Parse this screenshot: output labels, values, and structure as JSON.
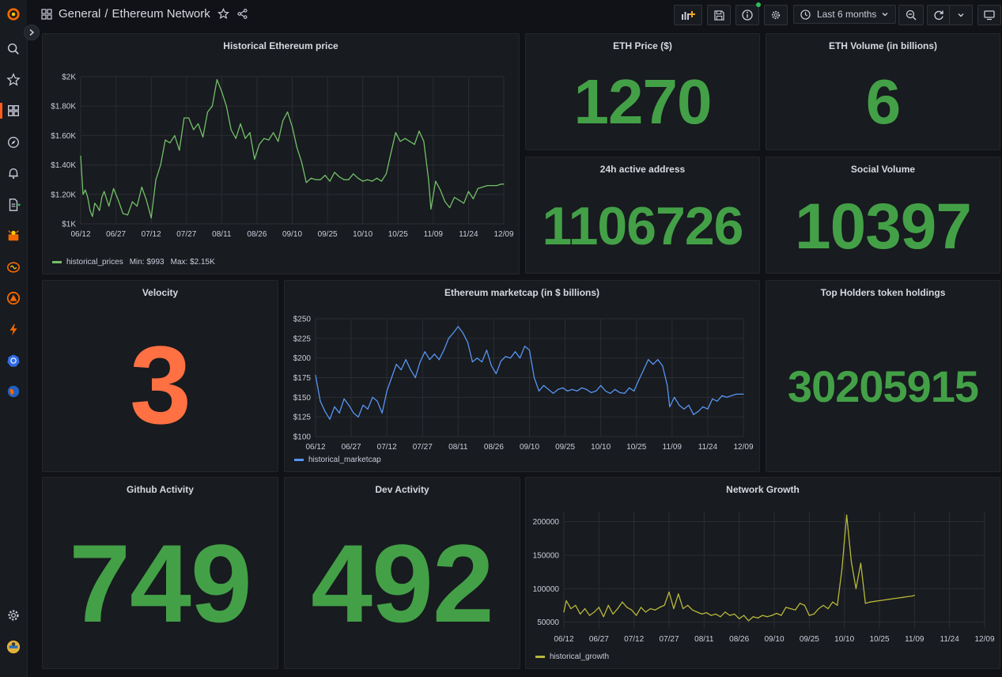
{
  "breadcrumb": {
    "folder": "General",
    "separator": "/",
    "dashboard": "Ethereum Network"
  },
  "time_picker": {
    "label": "Last 6 months"
  },
  "colors": {
    "stat_green": "#43a047",
    "velocity_orange": "#ff7043",
    "price_line": "#73bf69",
    "marketcap_line": "#5794f2",
    "growth_line": "#b8b83a"
  },
  "sidebar_icons": [
    "grafana-logo-icon",
    "search-icon",
    "star-icon",
    "dashboards-icon",
    "explore-icon",
    "alerting-icon",
    "reports-icon",
    "plugin-app-icon",
    "brain-plugin-icon",
    "plugin-app-icon",
    "lightning-icon",
    "kubernetes-icon",
    "globe-icon",
    "gear-icon",
    "avatar"
  ],
  "panels": {
    "price_chart": {
      "title": "Historical Ethereum price",
      "legend": {
        "name": "historical_prices",
        "min": "Min: $993",
        "max": "Max: $2.15K"
      }
    },
    "eth_price": {
      "title": "ETH Price ($)",
      "value": "1270"
    },
    "eth_volume": {
      "title": "ETH Volume (in billions)",
      "value": "6"
    },
    "active_address": {
      "title": "24h active address",
      "value": "1106726"
    },
    "social_volume": {
      "title": "Social Volume",
      "value": "10397"
    },
    "velocity": {
      "title": "Velocity",
      "value": "3"
    },
    "marketcap_chart": {
      "title": "Ethereum marketcap (in $ billions)",
      "legend": {
        "name": "historical_marketcap"
      }
    },
    "top_holders": {
      "title": "Top Holders token holdings",
      "value": "30205915"
    },
    "github": {
      "title": "Github Activity",
      "value": "749"
    },
    "dev": {
      "title": "Dev Activity",
      "value": "492"
    },
    "growth_chart": {
      "title": "Network Growth",
      "legend": {
        "name": "historical_growth"
      }
    }
  },
  "chart_data": [
    {
      "type": "line",
      "title": "Historical Ethereum price",
      "xticks": [
        "06/12",
        "06/27",
        "07/12",
        "07/27",
        "08/11",
        "08/26",
        "09/10",
        "09/25",
        "10/10",
        "10/25",
        "11/09",
        "11/24",
        "12/09"
      ],
      "yticks": [
        "$1K",
        "$1.20K",
        "$1.40K",
        "$1.60K",
        "$1.80K",
        "$2K"
      ],
      "ylim": [
        1000,
        2000
      ],
      "x_start": "06/12",
      "x_days": 180,
      "series": [
        {
          "name": "historical_prices",
          "x": [
            "06/12",
            "06/13",
            "06/14",
            "06/15",
            "06/16",
            "06/17",
            "06/18",
            "06/19",
            "06/20",
            "06/21",
            "06/22",
            "06/24",
            "06/26",
            "06/28",
            "06/30",
            "07/02",
            "07/04",
            "07/06",
            "07/08",
            "07/10",
            "07/12",
            "07/14",
            "07/16",
            "07/18",
            "07/20",
            "07/22",
            "07/24",
            "07/26",
            "07/28",
            "07/30",
            "08/01",
            "08/03",
            "08/05",
            "08/07",
            "08/09",
            "08/11",
            "08/13",
            "08/15",
            "08/17",
            "08/19",
            "08/21",
            "08/23",
            "08/25",
            "08/27",
            "08/29",
            "08/31",
            "09/02",
            "09/04",
            "09/06",
            "09/08",
            "09/10",
            "09/12",
            "09/14",
            "09/16",
            "09/18",
            "09/20",
            "09/22",
            "09/24",
            "09/26",
            "09/28",
            "09/30",
            "10/02",
            "10/04",
            "10/06",
            "10/08",
            "10/10",
            "10/12",
            "10/14",
            "10/16",
            "10/18",
            "10/20",
            "10/22",
            "10/24",
            "10/26",
            "10/28",
            "10/30",
            "11/01",
            "11/03",
            "11/05",
            "11/07",
            "11/08",
            "11/10",
            "11/12",
            "11/14",
            "11/16",
            "11/18",
            "11/20",
            "11/22",
            "11/24",
            "11/26",
            "11/28",
            "11/30",
            "12/02",
            "12/04",
            "12/06",
            "12/08",
            "12/09"
          ],
          "values": [
            1460,
            1200,
            1230,
            1180,
            1090,
            1050,
            1140,
            1120,
            1090,
            1180,
            1220,
            1120,
            1240,
            1160,
            1070,
            1060,
            1150,
            1120,
            1250,
            1160,
            1040,
            1300,
            1400,
            1570,
            1550,
            1600,
            1500,
            1720,
            1720,
            1640,
            1680,
            1590,
            1760,
            1800,
            1980,
            1900,
            1800,
            1640,
            1580,
            1680,
            1580,
            1620,
            1440,
            1540,
            1580,
            1570,
            1620,
            1560,
            1700,
            1760,
            1660,
            1520,
            1420,
            1280,
            1310,
            1300,
            1300,
            1330,
            1290,
            1350,
            1320,
            1300,
            1300,
            1340,
            1310,
            1290,
            1300,
            1290,
            1310,
            1290,
            1340,
            1480,
            1620,
            1560,
            1580,
            1560,
            1540,
            1630,
            1560,
            1300,
            1100,
            1290,
            1230,
            1150,
            1110,
            1180,
            1160,
            1140,
            1220,
            1170,
            1240,
            1250,
            1260,
            1260,
            1260,
            1270,
            1270
          ]
        }
      ]
    },
    {
      "type": "line",
      "title": "Ethereum marketcap (in $ billions)",
      "xticks": [
        "06/12",
        "06/27",
        "07/12",
        "07/27",
        "08/11",
        "08/26",
        "09/10",
        "09/25",
        "10/10",
        "10/25",
        "11/09",
        "11/24",
        "12/09"
      ],
      "yticks": [
        "$100",
        "$125",
        "$150",
        "$175",
        "$200",
        "$225",
        "$250"
      ],
      "ylim": [
        100,
        250
      ],
      "x_start": "06/12",
      "x_days": 180,
      "series": [
        {
          "name": "historical_marketcap",
          "x": [
            "06/12",
            "06/14",
            "06/16",
            "06/18",
            "06/20",
            "06/22",
            "06/24",
            "06/26",
            "06/28",
            "06/30",
            "07/02",
            "07/04",
            "07/06",
            "07/08",
            "07/10",
            "07/12",
            "07/14",
            "07/16",
            "07/18",
            "07/20",
            "07/22",
            "07/24",
            "07/26",
            "07/28",
            "07/30",
            "08/01",
            "08/03",
            "08/05",
            "08/07",
            "08/09",
            "08/11",
            "08/13",
            "08/15",
            "08/17",
            "08/19",
            "08/21",
            "08/23",
            "08/25",
            "08/27",
            "08/29",
            "08/31",
            "09/02",
            "09/04",
            "09/06",
            "09/08",
            "09/10",
            "09/12",
            "09/14",
            "09/16",
            "09/18",
            "09/20",
            "09/22",
            "09/24",
            "09/26",
            "09/28",
            "09/30",
            "10/02",
            "10/04",
            "10/06",
            "10/08",
            "10/10",
            "10/12",
            "10/14",
            "10/16",
            "10/18",
            "10/20",
            "10/22",
            "10/24",
            "10/26",
            "10/28",
            "10/30",
            "11/01",
            "11/03",
            "11/05",
            "11/07",
            "11/08",
            "11/10",
            "11/12",
            "11/14",
            "11/16",
            "11/18",
            "11/20",
            "11/22",
            "11/24",
            "11/26",
            "11/28",
            "11/30",
            "12/02",
            "12/04",
            "12/06",
            "12/09"
          ],
          "values": [
            178,
            145,
            132,
            122,
            138,
            130,
            148,
            140,
            130,
            125,
            140,
            135,
            150,
            145,
            130,
            158,
            175,
            192,
            185,
            198,
            185,
            175,
            195,
            208,
            198,
            205,
            198,
            210,
            225,
            232,
            240,
            232,
            220,
            195,
            200,
            195,
            210,
            190,
            180,
            196,
            202,
            200,
            208,
            200,
            215,
            210,
            175,
            158,
            165,
            160,
            155,
            160,
            162,
            158,
            160,
            158,
            162,
            160,
            156,
            158,
            165,
            158,
            155,
            160,
            156,
            155,
            162,
            158,
            172,
            185,
            198,
            192,
            198,
            190,
            165,
            138,
            150,
            140,
            135,
            140,
            128,
            132,
            138,
            135,
            148,
            145,
            152,
            150,
            152,
            154,
            154
          ]
        }
      ]
    },
    {
      "type": "line",
      "title": "Network Growth",
      "xticks": [
        "06/12",
        "06/27",
        "07/12",
        "07/27",
        "08/11",
        "08/26",
        "09/10",
        "09/25",
        "10/10",
        "10/25",
        "11/09",
        "11/24",
        "12/09"
      ],
      "yticks": [
        "50000",
        "100000",
        "150000",
        "200000"
      ],
      "ylim": [
        40000,
        215000
      ],
      "x_start": "06/12",
      "x_days": 180,
      "series": [
        {
          "name": "historical_growth",
          "x": [
            "06/12",
            "06/13",
            "06/15",
            "06/17",
            "06/19",
            "06/21",
            "06/23",
            "06/25",
            "06/27",
            "06/29",
            "07/01",
            "07/03",
            "07/05",
            "07/07",
            "07/09",
            "07/11",
            "07/13",
            "07/15",
            "07/17",
            "07/19",
            "07/21",
            "07/23",
            "07/25",
            "07/27",
            "07/29",
            "07/31",
            "08/02",
            "08/04",
            "08/06",
            "08/08",
            "08/10",
            "08/12",
            "08/14",
            "08/16",
            "08/18",
            "08/20",
            "08/22",
            "08/24",
            "08/26",
            "08/28",
            "08/30",
            "09/01",
            "09/03",
            "09/05",
            "09/07",
            "09/09",
            "09/11",
            "09/13",
            "09/15",
            "09/17",
            "09/19",
            "09/21",
            "09/23",
            "09/25",
            "09/27",
            "09/29",
            "10/01",
            "10/03",
            "10/05",
            "10/07",
            "10/09",
            "10/11",
            "10/13",
            "10/15",
            "10/17",
            "10/19",
            "10/21",
            "10/23",
            "10/25",
            "10/27",
            "10/29",
            "10/31",
            "11/02",
            "11/04",
            "11/06",
            "11/08",
            "11/09"
          ],
          "values": [
            65000,
            82000,
            70000,
            75000,
            62000,
            70000,
            60000,
            65000,
            72000,
            58000,
            75000,
            62000,
            70000,
            80000,
            72000,
            68000,
            60000,
            72000,
            65000,
            70000,
            68000,
            72000,
            75000,
            95000,
            70000,
            92000,
            70000,
            75000,
            68000,
            65000,
            62000,
            64000,
            60000,
            62000,
            58000,
            65000,
            60000,
            62000,
            55000,
            60000,
            52000,
            58000,
            56000,
            60000,
            58000,
            60000,
            63000,
            60000,
            72000,
            70000,
            68000,
            78000,
            75000,
            60000,
            62000,
            70000,
            75000,
            70000,
            80000,
            75000,
            130000,
            210000,
            140000,
            100000,
            138000,
            78000,
            80000,
            81000,
            82000,
            83000,
            84000,
            85000,
            86000,
            87000,
            88000,
            89000,
            90000
          ]
        }
      ]
    }
  ]
}
